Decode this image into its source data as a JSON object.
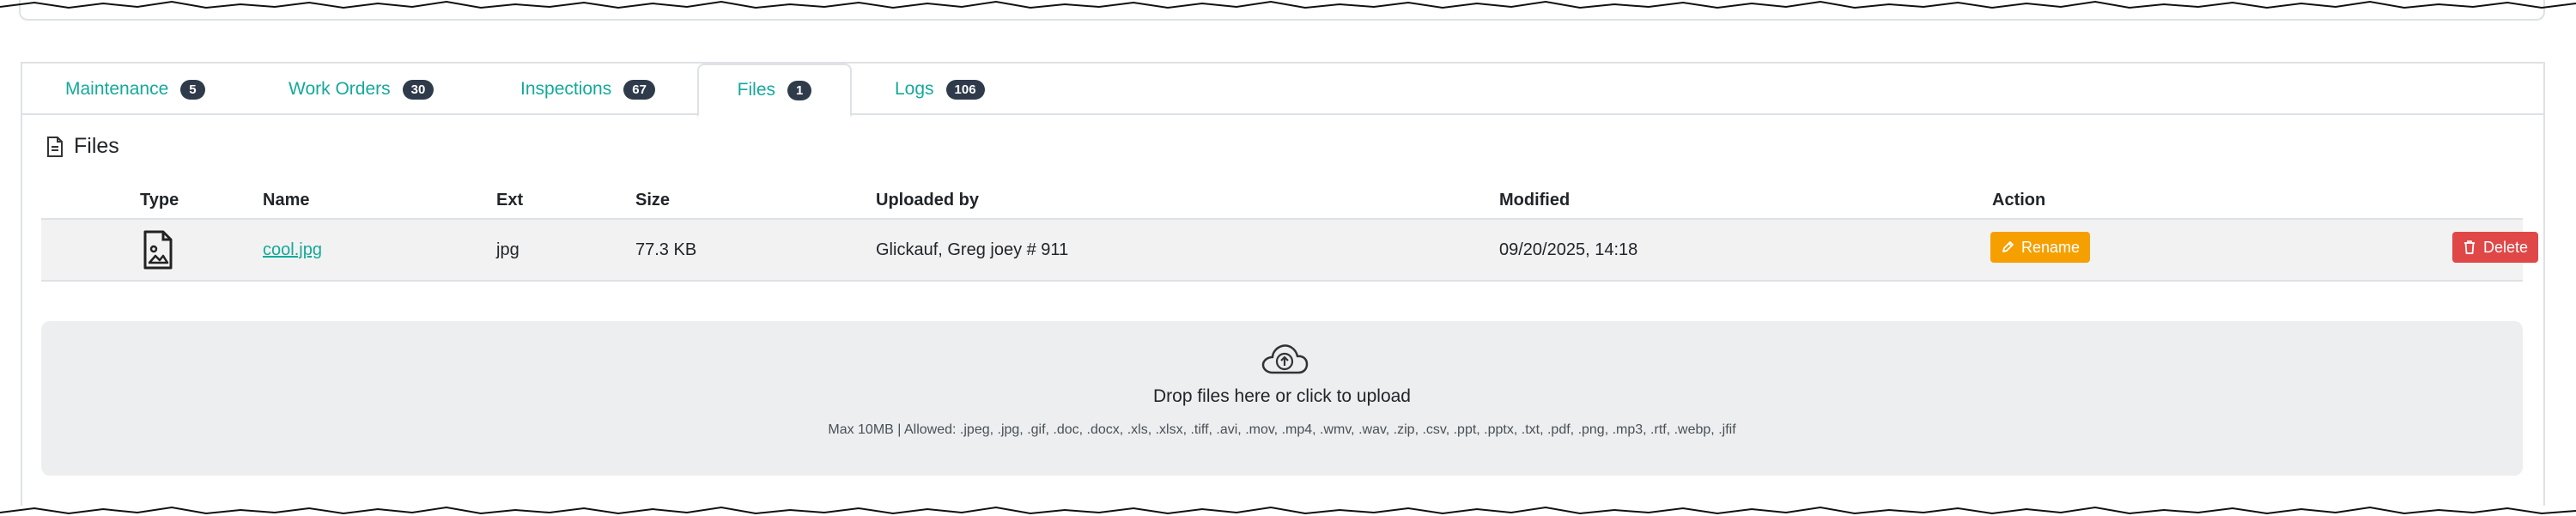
{
  "tabs": [
    {
      "label": "Maintenance",
      "count": "5"
    },
    {
      "label": "Work Orders",
      "count": "30"
    },
    {
      "label": "Inspections",
      "count": "67"
    },
    {
      "label": "Files",
      "count": "1"
    },
    {
      "label": "Logs",
      "count": "106"
    }
  ],
  "active_tab": "Files",
  "section": {
    "title": "Files",
    "icon": "document-icon"
  },
  "table": {
    "headers": [
      "Type",
      "Name",
      "Ext",
      "Size",
      "Uploaded by",
      "Modified",
      "Action"
    ],
    "rows": [
      {
        "type_icon": "image-file-icon",
        "name": "cool.jpg",
        "ext": "jpg",
        "size": "77.3 KB",
        "uploaded_by": "Glickauf, Greg joey # 911",
        "modified": "09/20/2025, 14:18",
        "rename_label": "Rename",
        "delete_label": "Delete"
      }
    ]
  },
  "upload": {
    "icon": "cloud-upload-icon",
    "title": "Drop files here or click to upload",
    "hint": "Max 10MB | Allowed: .jpeg, .jpg, .gif, .doc, .docx, .xls, .xlsx, .tiff, .avi, .mov, .mp4, .wmv, .wav, .zip, .csv, .ppt, .pptx, .txt, .pdf, .png, .mp3, .rtf, .webp, .jfif"
  },
  "colors": {
    "accent": "#14a99b",
    "badge": "#2f3b4a",
    "rename": "#f5a000",
    "delete": "#e04848",
    "dropzone_bg": "#eceeef",
    "row_bg": "#f2f2f2"
  }
}
